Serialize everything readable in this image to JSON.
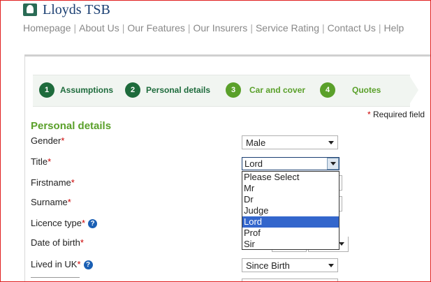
{
  "header": {
    "brand": "Lloyds TSB",
    "logo_icon": "horse-icon",
    "nav": [
      "Homepage",
      "About Us",
      "Our Features",
      "Our Insurers",
      "Service Rating",
      "Contact Us",
      "Help"
    ]
  },
  "steps": [
    {
      "number": "1",
      "label": "Assumptions",
      "state": "done"
    },
    {
      "number": "2",
      "label": "Personal details",
      "state": "current"
    },
    {
      "number": "3",
      "label": "Car and cover",
      "state": "upcoming"
    },
    {
      "number": "4",
      "label": "Quotes",
      "state": "upcoming"
    }
  ],
  "required_note": {
    "star": "*",
    "text": " Required field"
  },
  "section_title": "Personal details",
  "fields": {
    "gender": {
      "label": "Gender",
      "value": "Male"
    },
    "title": {
      "label": "Title",
      "value": "Lord"
    },
    "firstname": {
      "label": "Firstname"
    },
    "surname": {
      "label": "Surname"
    },
    "licence_type": {
      "label": "Licence type"
    },
    "date_of_birth": {
      "label": "Date of birth"
    },
    "lived_in_uk": {
      "label": "Lived in UK",
      "value": "Since Birth"
    }
  },
  "star": "*",
  "help_glyph": "?",
  "title_options": [
    "Please Select",
    "Mr",
    "Dr",
    "Judge",
    "Lord",
    "Prof",
    "Sir"
  ],
  "title_selected_index": 4,
  "colors": {
    "done_step": "#1e6b3c",
    "upcoming_step": "#5aa02a",
    "section_title": "#5aa02a",
    "required_star": "#cc0000",
    "help_icon": "#1a5fb4",
    "selected_option": "#3366cc"
  }
}
